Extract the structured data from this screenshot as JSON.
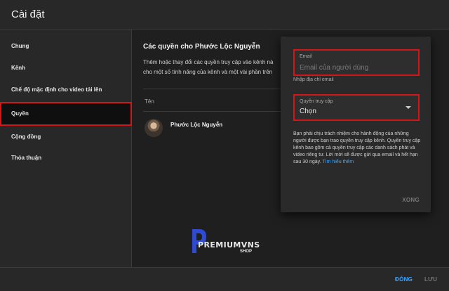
{
  "header": {
    "title": "Cài đặt"
  },
  "sidebar": {
    "items": [
      {
        "label": "Chung"
      },
      {
        "label": "Kênh"
      },
      {
        "label": "Chế độ mặc định cho video tải lên"
      },
      {
        "label": "Quyền"
      },
      {
        "label": "Cộng đồng"
      },
      {
        "label": "Thỏa thuận"
      }
    ],
    "active_index": 3
  },
  "main": {
    "section_title": "Các quyền cho Phước Lộc Nguyễn",
    "description_line1": "Thêm hoặc thay đổi các quyền truy cập vào kênh nà",
    "description_line2": "cho một số tính năng của kênh và một vài phần trên",
    "column_header": "Tên",
    "members": [
      {
        "name": "Phước Lộc Nguyễn"
      }
    ]
  },
  "popup": {
    "email": {
      "label": "Email",
      "placeholder": "Email của người dùng",
      "value": ""
    },
    "email_helper": "Nhập địa chỉ email",
    "access": {
      "label": "Quyền truy cập",
      "value": "Chọn"
    },
    "notice": "Bạn phải chịu trách nhiệm cho hành động của những người được bạn trao quyền truy cập kênh. Quyền truy cập kênh bao gồm cả quyền truy cập các danh sách phát và video riêng tư. Lời mời sẽ được gửi qua email và hết hạn sau 30 ngày.",
    "notice_link": "Tìm hiểu thêm",
    "done_label": "XONG"
  },
  "footer": {
    "close_label": "ĐÓNG",
    "save_label": "LƯU"
  },
  "watermark": {
    "brand": "PREMIUMVNS",
    "sub": "SHOP"
  },
  "colors": {
    "accent": "#3ea6ff",
    "highlight": "#d01818",
    "background": "#1f1f1f"
  }
}
